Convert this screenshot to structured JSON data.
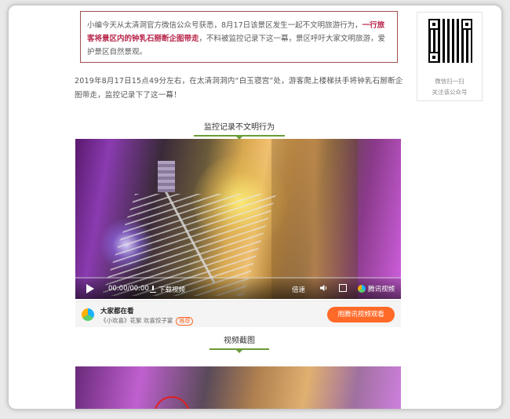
{
  "quote": {
    "text_before": "小编今天从太清洞官方微信公众号获悉，8月17日该景区发生一起不文明旅游行为，",
    "highlight": "一行旅客将景区内的钟乳石掰断企图带走",
    "text_after": "，不料被监控记录下这一幕，景区呼吁大家文明旅游，爱护景区自然景观。"
  },
  "paragraph": "2019年8月17日15点49分左右，在太清洞洞内“白玉寝宫”处，游客爬上楼梯扶手将钟乳石掰断企图带走，监控记录下了这一幕！",
  "caption1": "监控记录不文明行为",
  "video": {
    "time": "00:00/00:00",
    "download_label": "下载视频",
    "speed_label": "倍速",
    "brand_label": "腾讯视频"
  },
  "promo": {
    "title": "大家都在看",
    "subtitle": "《小欢喜》花絮 欢喜饺子宴",
    "tag": "推荐",
    "cta": "用腾讯视频观看"
  },
  "caption2": "视频截图",
  "sidebar": {
    "line1": "微信扫一扫",
    "line2": "关注该公众号"
  },
  "colors": {
    "highlight": "#b8254a",
    "accent_green": "#6b9b3a",
    "cta_orange": "#ff6a28"
  }
}
